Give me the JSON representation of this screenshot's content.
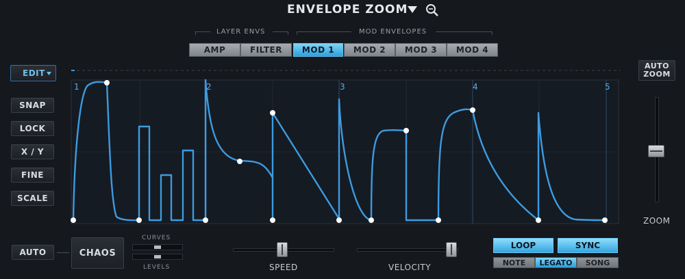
{
  "header": {
    "title": "ENVELOPE ZOOM"
  },
  "groups": {
    "layer": "LAYER ENVS",
    "mod": "MOD ENVELOPES"
  },
  "tabs": [
    {
      "label": "AMP",
      "active": false
    },
    {
      "label": "FILTER",
      "active": false
    },
    {
      "label": "MOD 1",
      "active": true
    },
    {
      "label": "MOD 2",
      "active": false
    },
    {
      "label": "MOD 3",
      "active": false
    },
    {
      "label": "MOD 4",
      "active": false
    }
  ],
  "edit": {
    "label": "EDIT"
  },
  "side_buttons": [
    "SNAP",
    "LOCK",
    "X / Y",
    "FINE",
    "SCALE"
  ],
  "auto_zoom": {
    "line1": "AUTO",
    "line2": "ZOOM"
  },
  "zoom": {
    "label": "ZOOM"
  },
  "graph": {
    "markers": [
      "1",
      "2",
      "3",
      "4",
      "5"
    ],
    "colors": {
      "curve": "#3d9be0",
      "marker": "#5aaee8",
      "bg": "#161c24"
    }
  },
  "bottom": {
    "auto": "AUTO",
    "chaos": "CHAOS",
    "curves": "CURVES",
    "levels": "LEVELS",
    "speed": "SPEED",
    "velocity": "VELOCITY",
    "loop": "LOOP",
    "sync": "SYNC",
    "modes": [
      {
        "label": "NOTE",
        "active": false
      },
      {
        "label": "LEGATO",
        "active": true
      },
      {
        "label": "SONG",
        "active": false
      }
    ]
  }
}
